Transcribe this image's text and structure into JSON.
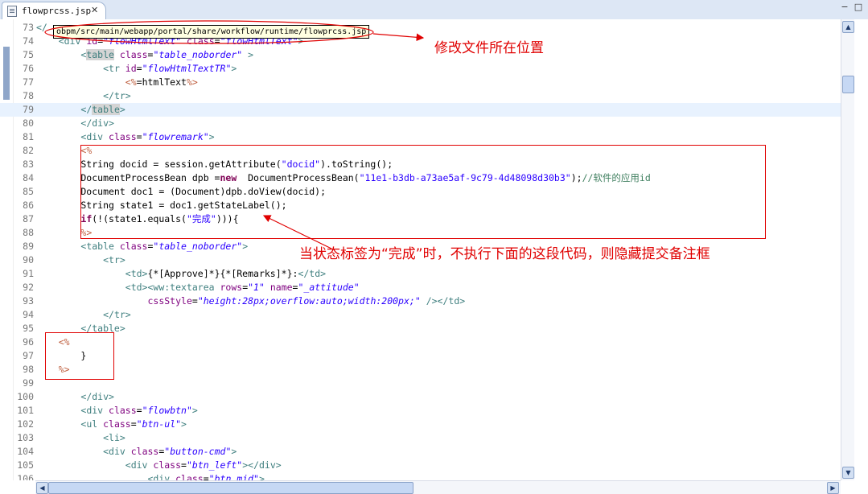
{
  "tab": {
    "filename": "flowprcss.jsp",
    "close_glyph": "✕"
  },
  "window": {
    "minimize": "−",
    "maximize": "□"
  },
  "tooltip": {
    "path": "obpm/src/main/webapp/portal/share/workflow/runtime/flowprcss.jsp"
  },
  "annotations": {
    "file_location": "修改文件所在位置",
    "condition_note": "当状态标签为“完成”时，不执行下面的这段代码，则隐藏提交备注框"
  },
  "editor": {
    "current_line": "79",
    "lines": [
      {
        "n": "73",
        "segs": [
          [
            "t-tag",
            "</"
          ]
        ]
      },
      {
        "n": "74",
        "segs": [
          [
            "t-plain",
            "    "
          ],
          [
            "t-tag",
            "<div "
          ],
          [
            "t-attr",
            "id"
          ],
          [
            "t-plain",
            "="
          ],
          [
            "t-str",
            "\"flowHtmlText\""
          ],
          [
            "t-plain",
            " "
          ],
          [
            "t-attr",
            "class"
          ],
          [
            "t-plain",
            "="
          ],
          [
            "t-str",
            "\"flowHtmlText\""
          ],
          [
            "t-tag",
            ">"
          ]
        ]
      },
      {
        "n": "75",
        "segs": [
          [
            "t-plain",
            "        "
          ],
          [
            "t-tag",
            "<"
          ],
          [
            "t-tag boxmatch",
            "table"
          ],
          [
            "t-plain",
            " "
          ],
          [
            "t-attr",
            "class"
          ],
          [
            "t-plain",
            "="
          ],
          [
            "t-str",
            "\"table_noborder\""
          ],
          [
            "t-plain",
            " "
          ],
          [
            "t-tag",
            ">"
          ]
        ]
      },
      {
        "n": "76",
        "segs": [
          [
            "t-plain",
            "            "
          ],
          [
            "t-tag",
            "<tr "
          ],
          [
            "t-attr",
            "id"
          ],
          [
            "t-plain",
            "="
          ],
          [
            "t-str",
            "\"flowHtmlTextTR\""
          ],
          [
            "t-tag",
            ">"
          ]
        ]
      },
      {
        "n": "77",
        "segs": [
          [
            "t-plain",
            "                "
          ],
          [
            "t-jsp",
            "<%"
          ],
          [
            "t-plain",
            "=htmlText"
          ],
          [
            "t-jsp",
            "%>"
          ]
        ]
      },
      {
        "n": "78",
        "segs": [
          [
            "t-plain",
            "            "
          ],
          [
            "t-tag",
            "</tr>"
          ]
        ]
      },
      {
        "n": "79",
        "segs": [
          [
            "t-plain",
            "        "
          ],
          [
            "t-tag",
            "</"
          ],
          [
            "t-tag boxmatch",
            "table"
          ],
          [
            "t-tag",
            ">"
          ]
        ]
      },
      {
        "n": "80",
        "segs": [
          [
            "t-plain",
            "        "
          ],
          [
            "t-tag",
            "</div>"
          ]
        ]
      },
      {
        "n": "81",
        "segs": [
          [
            "t-plain",
            "        "
          ],
          [
            "t-tag",
            "<div "
          ],
          [
            "t-attr",
            "class"
          ],
          [
            "t-plain",
            "="
          ],
          [
            "t-str",
            "\"flowremark\""
          ],
          [
            "t-tag",
            ">"
          ]
        ]
      },
      {
        "n": "82",
        "segs": [
          [
            "t-plain",
            "        "
          ],
          [
            "t-jsp",
            "<%"
          ]
        ]
      },
      {
        "n": "83",
        "segs": [
          [
            "t-plain",
            "        String docid = session.getAttribute("
          ],
          [
            "t-jstr",
            "\"docid\""
          ],
          [
            "t-plain",
            ").toString();"
          ]
        ]
      },
      {
        "n": "84",
        "segs": [
          [
            "t-plain",
            "        DocumentProcessBean dpb ="
          ],
          [
            "t-kw",
            "new"
          ],
          [
            "t-plain",
            "  DocumentProcessBean("
          ],
          [
            "t-jstr",
            "\"11e1-b3db-a73ae5af-9c79-4d48098d30b3\""
          ],
          [
            "t-plain",
            ");"
          ],
          [
            "t-cmt",
            "//软件的应用id"
          ]
        ]
      },
      {
        "n": "85",
        "segs": [
          [
            "t-plain",
            "        Document doc1 = (Document)dpb.doView(docid);"
          ]
        ]
      },
      {
        "n": "86",
        "segs": [
          [
            "t-plain",
            "        String state1 = doc1.getStateLabel();"
          ]
        ]
      },
      {
        "n": "87",
        "segs": [
          [
            "t-plain",
            "        "
          ],
          [
            "t-kw",
            "if"
          ],
          [
            "t-plain",
            "(!(state1.equals("
          ],
          [
            "t-jstr",
            "\"完成\""
          ],
          [
            "t-plain",
            "))){"
          ]
        ]
      },
      {
        "n": "88",
        "segs": [
          [
            "t-plain",
            "        "
          ],
          [
            "t-jsp",
            "%>"
          ]
        ]
      },
      {
        "n": "89",
        "segs": [
          [
            "t-plain",
            "        "
          ],
          [
            "t-tag",
            "<table "
          ],
          [
            "t-attr",
            "class"
          ],
          [
            "t-plain",
            "="
          ],
          [
            "t-str",
            "\"table_noborder\""
          ],
          [
            "t-tag",
            ">"
          ]
        ]
      },
      {
        "n": "90",
        "segs": [
          [
            "t-plain",
            "            "
          ],
          [
            "t-tag",
            "<tr>"
          ]
        ]
      },
      {
        "n": "91",
        "segs": [
          [
            "t-plain",
            "                "
          ],
          [
            "t-tag",
            "<td>"
          ],
          [
            "t-plain",
            "{*[Approve]*}{*[Remarks]*}:"
          ],
          [
            "t-tag",
            "</td>"
          ]
        ]
      },
      {
        "n": "92",
        "segs": [
          [
            "t-plain",
            "                "
          ],
          [
            "t-tag",
            "<td><ww:textarea "
          ],
          [
            "t-attr",
            "rows"
          ],
          [
            "t-plain",
            "="
          ],
          [
            "t-str",
            "\"1\""
          ],
          [
            "t-plain",
            " "
          ],
          [
            "t-attr",
            "name"
          ],
          [
            "t-plain",
            "="
          ],
          [
            "t-str",
            "\"_attitude\""
          ]
        ]
      },
      {
        "n": "93",
        "segs": [
          [
            "t-plain",
            "                    "
          ],
          [
            "t-attr",
            "cssStyle"
          ],
          [
            "t-plain",
            "="
          ],
          [
            "t-str",
            "\"height:28px;overflow:auto;width:200px;\""
          ],
          [
            "t-plain",
            " "
          ],
          [
            "t-tag",
            "/></td>"
          ]
        ]
      },
      {
        "n": "94",
        "segs": [
          [
            "t-plain",
            "            "
          ],
          [
            "t-tag",
            "</tr>"
          ]
        ]
      },
      {
        "n": "95",
        "segs": [
          [
            "t-plain",
            "        "
          ],
          [
            "t-tag",
            "</table>"
          ]
        ]
      },
      {
        "n": "96",
        "segs": [
          [
            "t-plain",
            "    "
          ],
          [
            "t-jsp",
            "<%"
          ]
        ]
      },
      {
        "n": "97",
        "segs": [
          [
            "t-plain",
            "        }"
          ]
        ]
      },
      {
        "n": "98",
        "segs": [
          [
            "t-plain",
            "    "
          ],
          [
            "t-jsp",
            "%>"
          ]
        ]
      },
      {
        "n": "99",
        "segs": []
      },
      {
        "n": "100",
        "segs": [
          [
            "t-plain",
            "        "
          ],
          [
            "t-tag",
            "</div>"
          ]
        ]
      },
      {
        "n": "101",
        "segs": [
          [
            "t-plain",
            "        "
          ],
          [
            "t-tag",
            "<div "
          ],
          [
            "t-attr",
            "class"
          ],
          [
            "t-plain",
            "="
          ],
          [
            "t-str",
            "\"flowbtn\""
          ],
          [
            "t-tag",
            ">"
          ]
        ]
      },
      {
        "n": "102",
        "segs": [
          [
            "t-plain",
            "        "
          ],
          [
            "t-tag",
            "<ul "
          ],
          [
            "t-attr",
            "class"
          ],
          [
            "t-plain",
            "="
          ],
          [
            "t-str",
            "\"btn-ul\""
          ],
          [
            "t-tag",
            ">"
          ]
        ]
      },
      {
        "n": "103",
        "segs": [
          [
            "t-plain",
            "            "
          ],
          [
            "t-tag",
            "<li>"
          ]
        ]
      },
      {
        "n": "104",
        "segs": [
          [
            "t-plain",
            "            "
          ],
          [
            "t-tag",
            "<div "
          ],
          [
            "t-attr",
            "class"
          ],
          [
            "t-plain",
            "="
          ],
          [
            "t-str",
            "\"button-cmd\""
          ],
          [
            "t-tag",
            ">"
          ]
        ]
      },
      {
        "n": "105",
        "segs": [
          [
            "t-plain",
            "                "
          ],
          [
            "t-tag",
            "<div "
          ],
          [
            "t-attr",
            "class"
          ],
          [
            "t-plain",
            "="
          ],
          [
            "t-str",
            "\"btn_left\""
          ],
          [
            "t-tag",
            "></div>"
          ]
        ]
      },
      {
        "n": "106",
        "segs": [
          [
            "t-plain",
            "                    "
          ],
          [
            "t-tag",
            "<div "
          ],
          [
            "t-attr",
            "class"
          ],
          [
            "t-plain",
            "="
          ],
          [
            "t-str",
            "\"btn_mid\""
          ],
          [
            "t-tag",
            ">"
          ]
        ]
      }
    ]
  }
}
